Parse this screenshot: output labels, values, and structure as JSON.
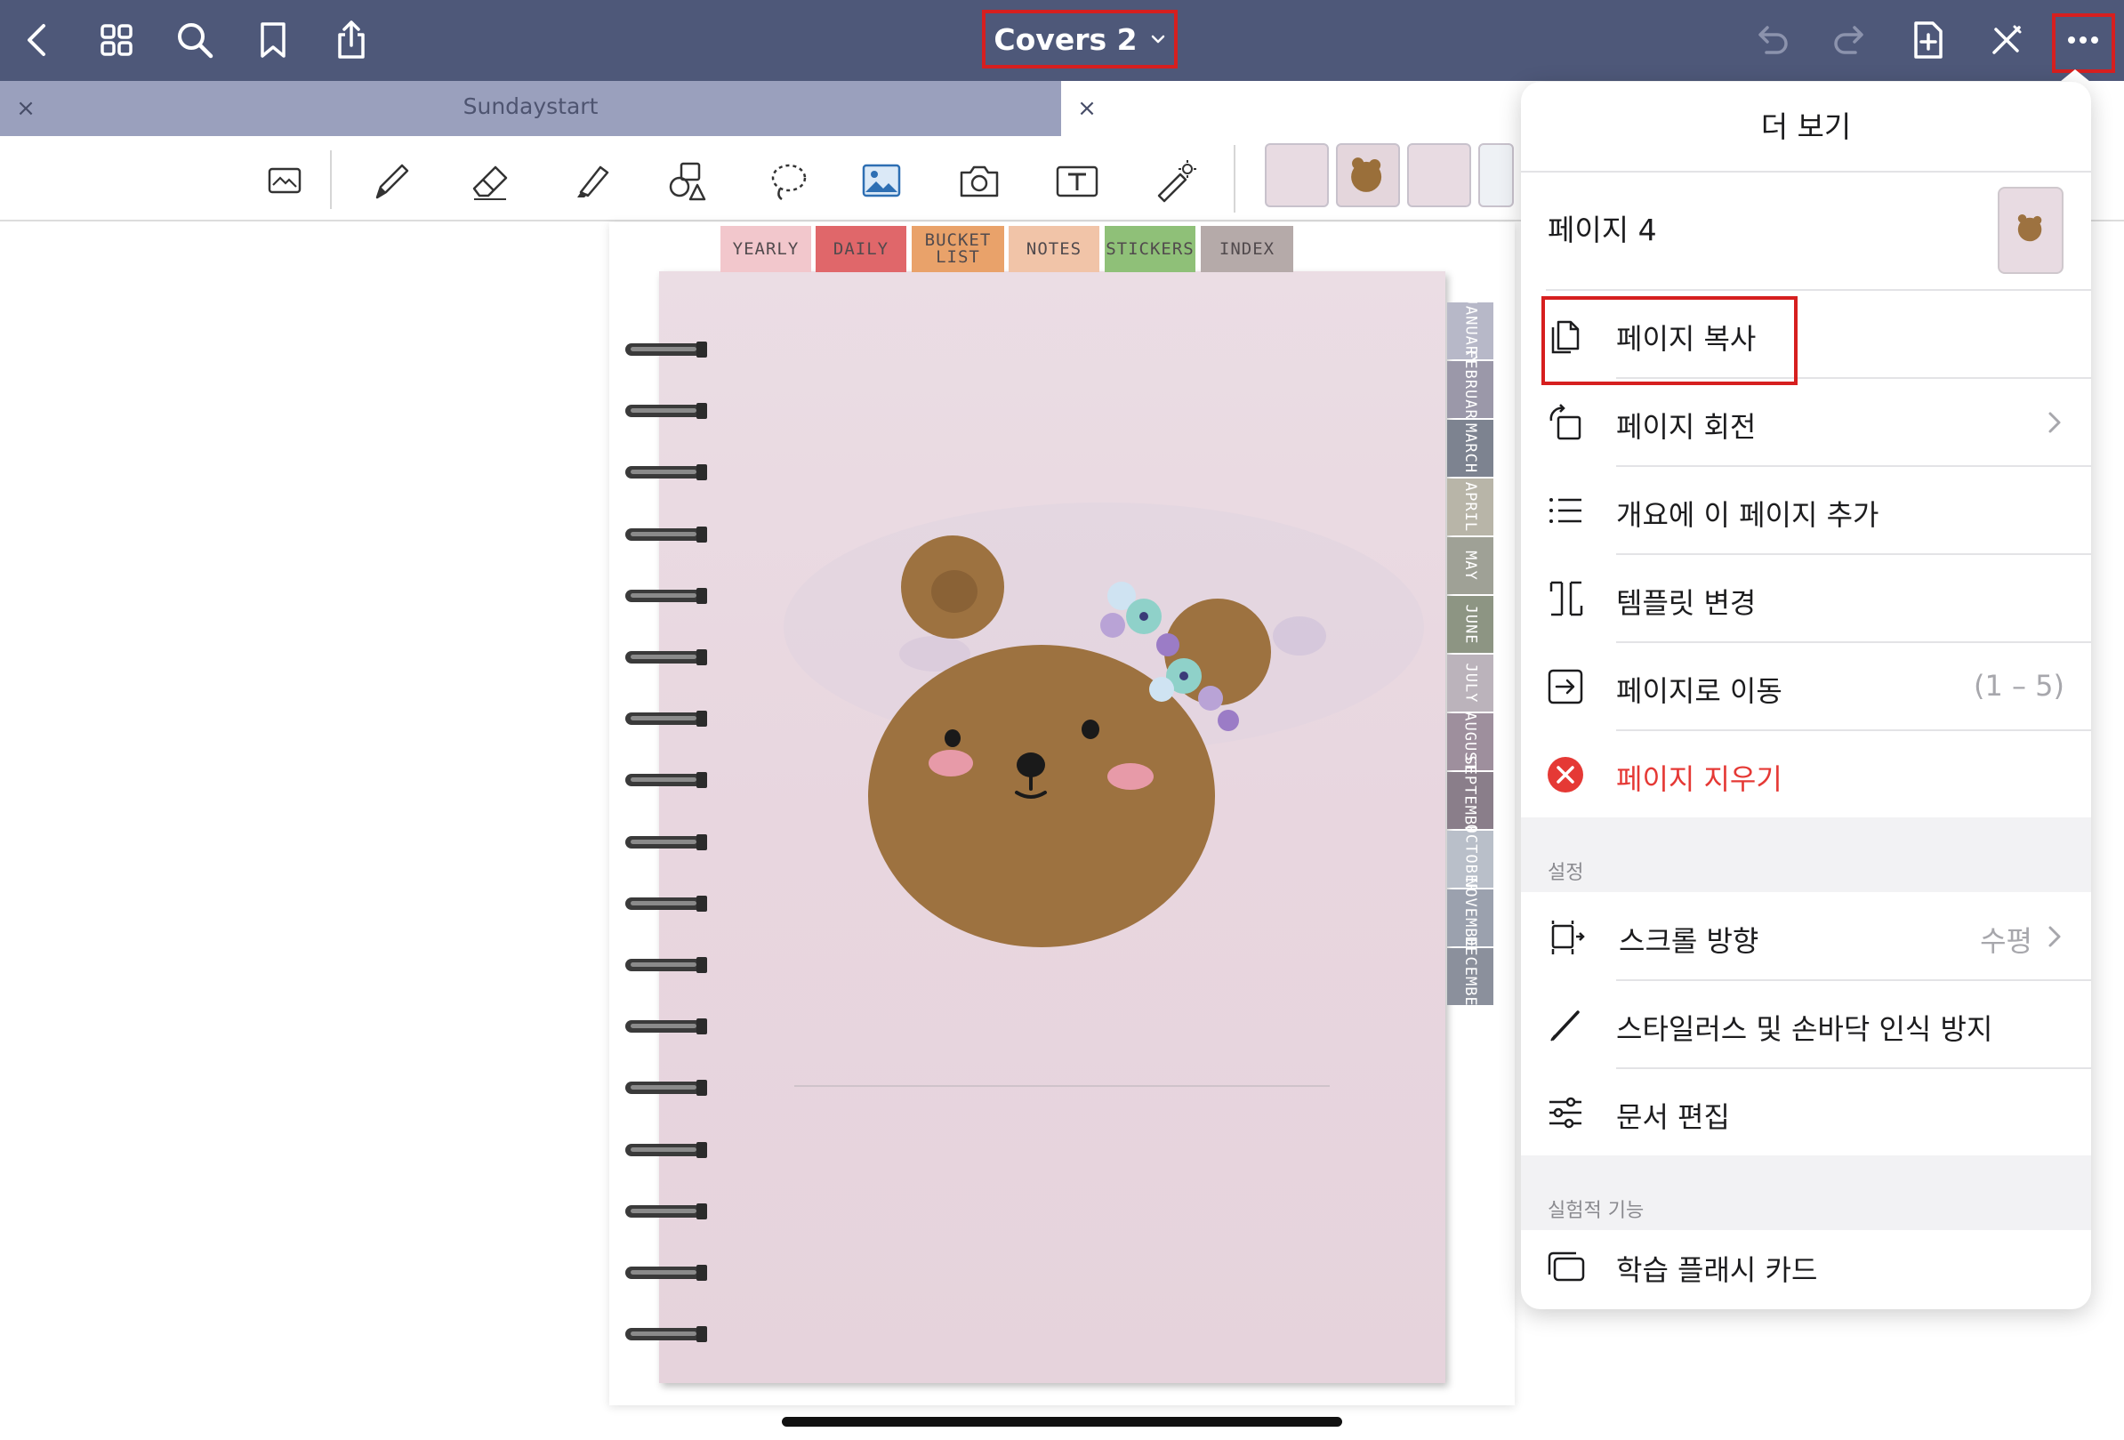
{
  "topbar": {
    "title": "Covers 2",
    "icons": [
      "back-icon",
      "grid-icon",
      "search-icon",
      "bookmark-icon",
      "share-icon",
      "undo-icon",
      "redo-icon",
      "add-page-icon",
      "close-tools-icon",
      "more-icon"
    ]
  },
  "tabs": {
    "left_tab": "Sundaystart",
    "close_glyph": "×"
  },
  "notebook": {
    "top_tabs": [
      {
        "label": "YEARLY",
        "color": "#f2c7cc"
      },
      {
        "label": "DAILY",
        "color": "#e0676a"
      },
      {
        "label": "BUCKET\nLIST",
        "color": "#e9a26a"
      },
      {
        "label": "NOTES",
        "color": "#f1c4a8"
      },
      {
        "label": "STICKERS",
        "color": "#8fc078"
      },
      {
        "label": "INDEX",
        "color": "#b5aaa9"
      }
    ],
    "side_tabs": [
      {
        "label": "JANUARY",
        "color": "#b7b8c8"
      },
      {
        "label": "FEBRUARY",
        "color": "#9b98a9"
      },
      {
        "label": "MARCH",
        "color": "#7d8390"
      },
      {
        "label": "APRIL",
        "color": "#b8b5a8"
      },
      {
        "label": "MAY",
        "color": "#9fa196"
      },
      {
        "label": "JUNE",
        "color": "#8d9583"
      },
      {
        "label": "JULY",
        "color": "#bbb3bb"
      },
      {
        "label": "AUGUST",
        "color": "#9e8f9d"
      },
      {
        "label": "SEPTEMBER",
        "color": "#8a7e8a"
      },
      {
        "label": "OCTOBER",
        "color": "#b9bfc9"
      },
      {
        "label": "NOVEMBER",
        "color": "#9ba1ae"
      },
      {
        "label": "DECEMBER",
        "color": "#8b909c"
      }
    ]
  },
  "menu": {
    "title": "더 보기",
    "page_label": "페이지 4",
    "items": [
      {
        "label": "페이지 복사",
        "icon": "copy-page-icon"
      },
      {
        "label": "페이지 회전",
        "icon": "rotate-page-icon"
      },
      {
        "label": "개요에 이 페이지 추가",
        "icon": "outline-icon"
      },
      {
        "label": "템플릿 변경",
        "icon": "template-icon"
      },
      {
        "label": "페이지로 이동",
        "value": "(1 – 5)",
        "icon": "go-to-page-icon"
      },
      {
        "label": "페이지 지우기",
        "icon": "delete-page-icon"
      }
    ],
    "settings_header": "설정",
    "settings": [
      {
        "label": "스크롤 방향",
        "value": "수평",
        "icon": "scroll-direction-icon"
      },
      {
        "label": "스타일러스 및 손바닥 인식 방지",
        "icon": "stylus-icon"
      },
      {
        "label": "문서 편집",
        "icon": "edit-document-icon"
      }
    ],
    "experimental_header": "실험적 기능",
    "experimental": [
      {
        "label": "학습 플래시 카드",
        "icon": "flashcards-icon"
      }
    ]
  },
  "colors": {
    "topbar": "#4e5879",
    "highlight": "#d61f1f",
    "destructive": "#e53935"
  }
}
